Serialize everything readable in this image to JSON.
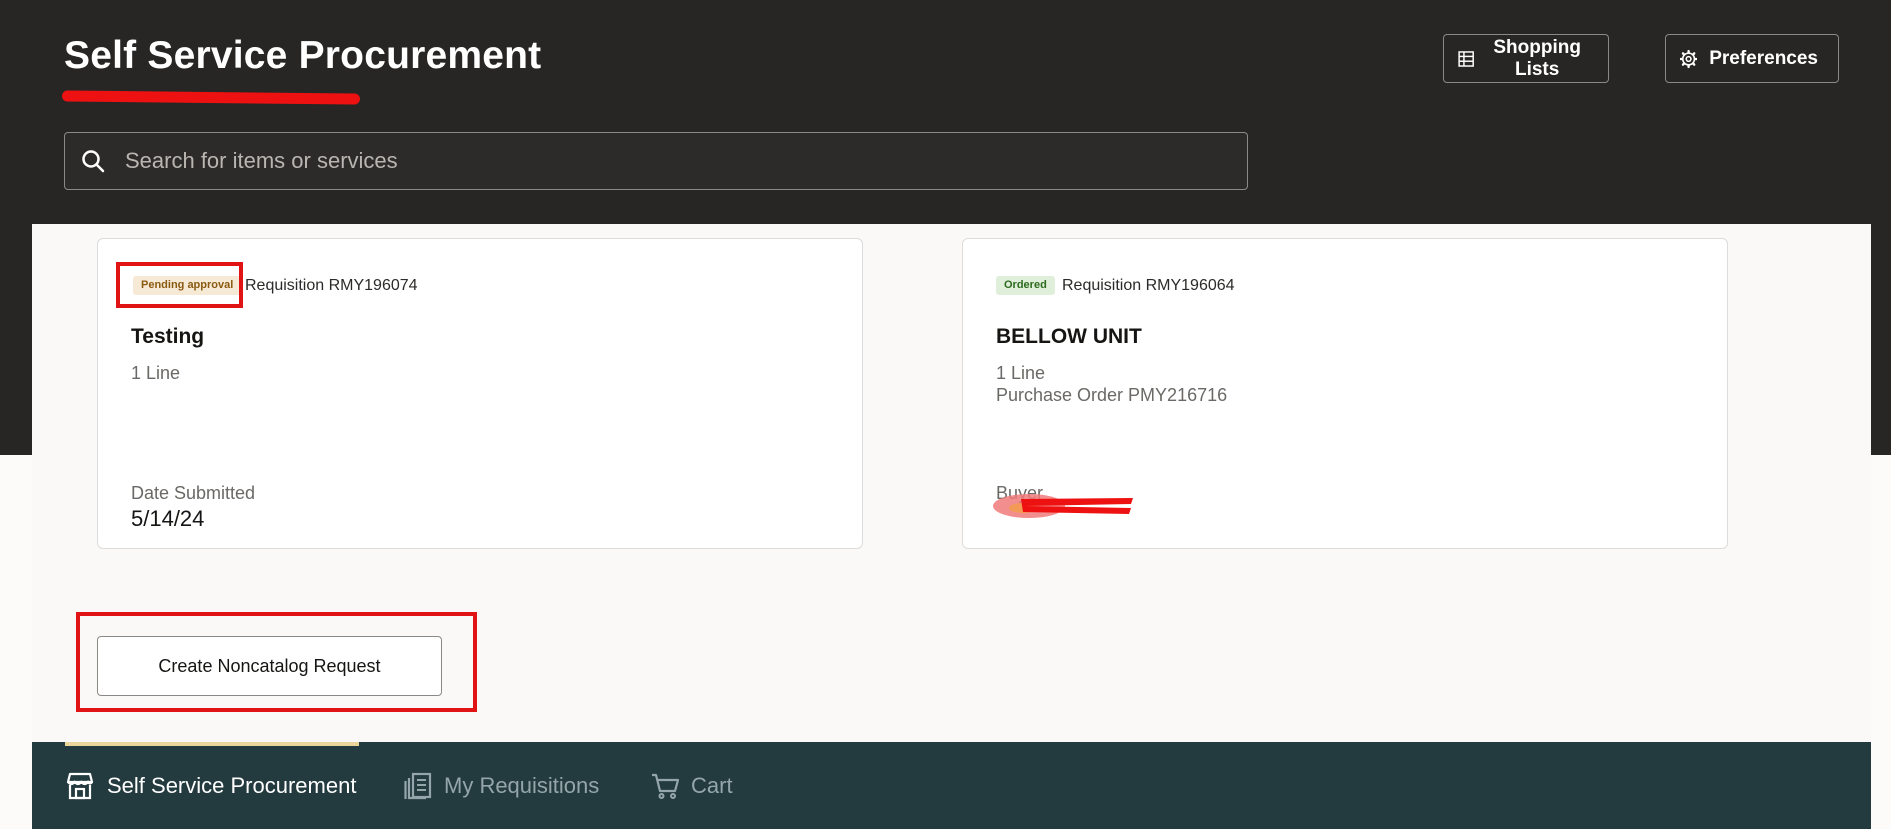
{
  "header": {
    "title": "Self Service Procurement",
    "shopping_lists_label": "Shopping Lists",
    "preferences_label": "Preferences"
  },
  "search": {
    "placeholder": "Search for items or services"
  },
  "requisitions": [
    {
      "status": "Pending approval",
      "number": "Requisition RMY196074",
      "title": "Testing",
      "lines": "1 Line",
      "detail_label": "Date Submitted",
      "detail_value": "5/14/24"
    },
    {
      "status": "Ordered",
      "number": "Requisition RMY196064",
      "title": "BELLOW UNIT",
      "lines": "1 Line",
      "purchase_order": "Purchase Order PMY216716",
      "detail_label": "Buyer"
    }
  ],
  "actions": {
    "create_noncatalog_label": "Create Noncatalog Request"
  },
  "bottom_nav": {
    "items": [
      {
        "label": "Self Service Procurement",
        "icon": "store-icon",
        "active": true
      },
      {
        "label": "My Requisitions",
        "icon": "requisitions-icon",
        "active": false
      },
      {
        "label": "Cart",
        "icon": "cart-icon",
        "active": false
      }
    ]
  },
  "colors": {
    "header_bg": "#272624",
    "bottom_nav_bg": "#233a3f",
    "active_indicator": "#ebd59b",
    "highlight": "#e01414"
  }
}
